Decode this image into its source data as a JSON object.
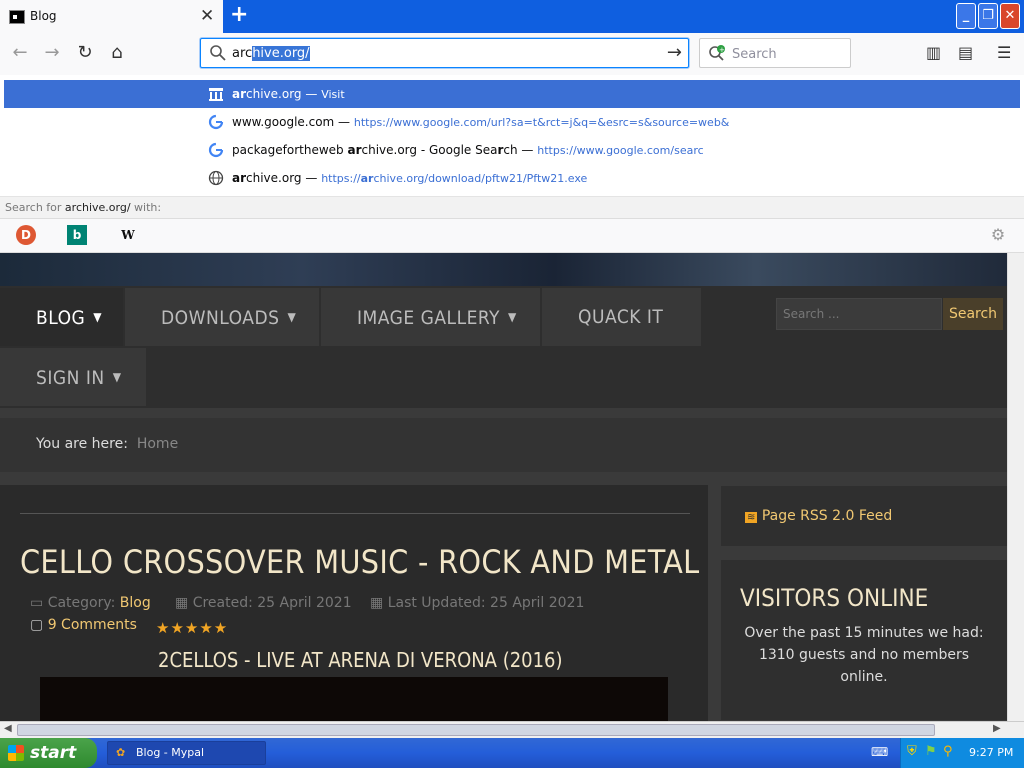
{
  "browser": {
    "tab_title": "Blog",
    "url_typed": "arc",
    "url_selected": "hive.org/",
    "search_placeholder": "Search",
    "suggestions": [
      {
        "bold": "ar",
        "rest": "chive.org",
        "sep": " — ",
        "extra": "Visit"
      },
      {
        "bold": "",
        "rest": "www.google.com",
        "sep": " — ",
        "extra": "https://www.google.com/url?sa=t&rct=j&q=&esrc=s&source=web&"
      },
      {
        "bold_prefix": "packagefortheweb ",
        "bold": "ar",
        "rest": "chive.org - Google Sea",
        "bold2": "r",
        "rest2": "ch",
        "sep": " — ",
        "extra": "https://www.google.com/searc"
      },
      {
        "bold": "ar",
        "rest": "chive.org",
        "sep": " — ",
        "extra_pre": "https://",
        "extra_bold": "ar",
        "extra": "chive.org/download/pftw21/Pftw21.exe"
      }
    ],
    "search_for_prefix": "Search for ",
    "search_for_query": "archive.org/",
    "search_for_suffix": " with:"
  },
  "site": {
    "menu": [
      "BLOG",
      "DOWNLOADS",
      "IMAGE GALLERY",
      "QUACK IT",
      "SIGN IN"
    ],
    "search_placeholder": "Search ...",
    "search_button": "Search",
    "breadcrumb_label": "You are here:",
    "breadcrumb_home": "Home",
    "article": {
      "title": "CELLO CROSSOVER MUSIC - ROCK AND METAL",
      "category_label": "Category:",
      "category": "Blog",
      "created": "Created: 25 April 2021",
      "updated": "Last Updated: 25 April 2021",
      "comments": "9 Comments",
      "rating_stars": 5,
      "video_title": "2CELLOS - LIVE AT ARENA DI VERONA (2016)"
    },
    "sidebar": {
      "rss": "Page RSS 2.0 Feed",
      "visitors_title": "VISITORS ONLINE",
      "visitors_text": "Over the past 15 minutes we had: 1310 guests and no members online."
    }
  },
  "taskbar": {
    "start": "start",
    "task": "Blog - Mypal",
    "time": "9:27 PM"
  },
  "colors": {
    "accent": "#3b6fd4",
    "gold": "#f1c872",
    "title_cream": "#f2e6c8"
  }
}
